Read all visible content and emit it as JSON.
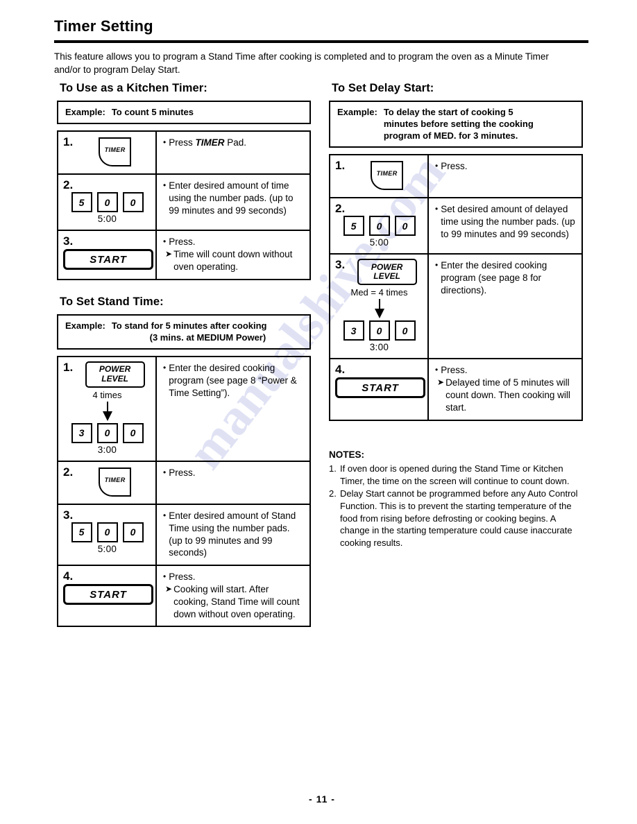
{
  "document": {
    "title": "Timer Setting",
    "intro": "This feature allows you to program a Stand Time after cooking is completed and to program the oven as a Minute Timer and/or to program Delay Start.",
    "page_number": "- 11 -",
    "watermark": "manualshive.com"
  },
  "sections": {
    "kitchen_timer": {
      "heading": "To Use as a Kitchen Timer:",
      "example_label": "Example:",
      "example_lines": [
        "To count 5 minutes"
      ],
      "steps": [
        {
          "num": "1.",
          "pad": "TIMER",
          "bullet": "Press ",
          "bullet_italic": "TIMER",
          "bullet_tail": " Pad."
        },
        {
          "num": "2.",
          "keys": [
            "5",
            "0",
            "0"
          ],
          "time": "5:00",
          "bullet": "Enter desired amount of time using the number pads. (up to 99 minutes and 99 seconds)"
        },
        {
          "num": "3.",
          "pad": "START",
          "bullet": "Press.",
          "arrow": "Time will count down without oven operating."
        }
      ]
    },
    "stand_time": {
      "heading": "To Set Stand Time:",
      "example_label": "Example:",
      "example_lines": [
        "To stand for 5 minutes after cooking",
        "(3 mins. at MEDIUM Power)"
      ],
      "steps": [
        {
          "num": "1.",
          "power_pad_line1": "POWER",
          "power_pad_line2": "LEVEL",
          "times": "4 times",
          "keys": [
            "3",
            "0",
            "0"
          ],
          "time": "3:00",
          "bullet": "Enter the desired cooking program (see page 8 “Power & Time Setting”)."
        },
        {
          "num": "2.",
          "pad": "TIMER",
          "bullet": "Press."
        },
        {
          "num": "3.",
          "keys": [
            "5",
            "0",
            "0"
          ],
          "time": "5:00",
          "bullet": "Enter desired amount of Stand Time using the number pads. (up to 99 minutes and 99 seconds)"
        },
        {
          "num": "4.",
          "pad": "START",
          "bullet": "Press.",
          "arrow": "Cooking will start. After cooking, Stand Time will count down without oven operating."
        }
      ]
    },
    "delay_start": {
      "heading": "To Set Delay Start:",
      "example_label": "Example:",
      "example_lines": [
        "To delay the start of cooking 5",
        "minutes before setting the cooking",
        "program of MED. for 3 minutes."
      ],
      "steps": [
        {
          "num": "1.",
          "pad": "TIMER",
          "bullet": "Press."
        },
        {
          "num": "2.",
          "keys": [
            "5",
            "0",
            "0"
          ],
          "time": "5:00",
          "bullet": "Set desired amount of delayed time using the number pads. (up to 99 minutes and 99 seconds)"
        },
        {
          "num": "3.",
          "power_pad_line1": "POWER",
          "power_pad_line2": "LEVEL",
          "times": "Med = 4 times",
          "keys": [
            "3",
            "0",
            "0"
          ],
          "time": "3:00",
          "bullet": "Enter the desired cooking program (see page 8 for directions)."
        },
        {
          "num": "4.",
          "pad": "START",
          "bullet": "Press.",
          "arrow": "Delayed time of 5 minutes will count down. Then cooking will start."
        }
      ]
    }
  },
  "notes": {
    "title": "NOTES:",
    "items": [
      {
        "marker": "1.",
        "text": "If oven door is opened during the Stand Time or Kitchen Timer, the time on the screen will continue to count down."
      },
      {
        "marker": "2.",
        "text": "Delay Start cannot be programmed before any Auto Control Function. This is to prevent the starting temperature of the food from rising before defrosting or cooking begins. A change in the starting temperature could cause inaccurate cooking results."
      }
    ]
  },
  "symbols": {
    "bullet": "•",
    "arrow": "➤"
  }
}
